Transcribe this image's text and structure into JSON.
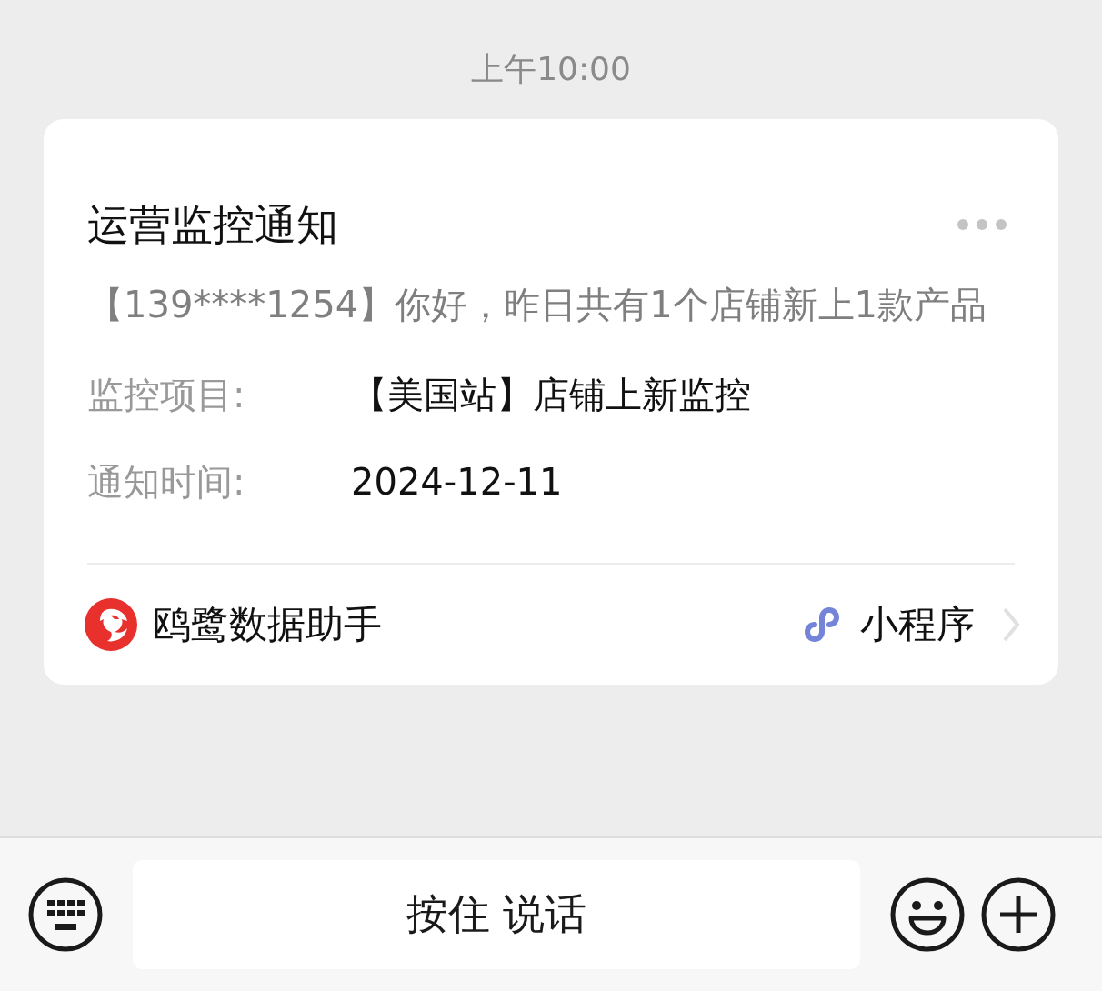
{
  "timestamp": "上午10:00",
  "card": {
    "title": "运营监控通知",
    "message": "【139****1254】你好，昨日共有1个店铺新上1款产品",
    "fields": [
      {
        "label": "监控项目:",
        "value": "【美国站】店铺上新监控"
      },
      {
        "label": "通知时间:",
        "value": "2024-12-11"
      }
    ],
    "app_name": "鸥鹭数据助手",
    "tag": "小程序"
  },
  "input_bar": {
    "hold_to_talk": "按住 说话"
  }
}
